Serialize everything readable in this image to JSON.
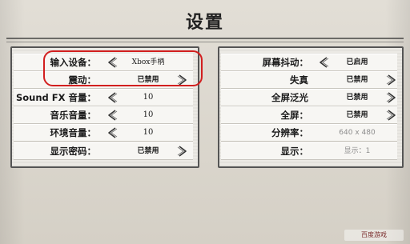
{
  "header": {
    "title": "设置"
  },
  "left_settings": [
    {
      "label": "输入设备：",
      "value": "Xbox手柄",
      "has_left_arrow": true,
      "has_right_arrow": false
    },
    {
      "label": "震动：",
      "value": "已禁用",
      "has_left_arrow": false,
      "has_right_arrow": true
    },
    {
      "label": "Sound FX 音量：",
      "value": "10",
      "has_left_arrow": true,
      "has_right_arrow": false
    },
    {
      "label": "音乐音量：",
      "value": "10",
      "has_left_arrow": true,
      "has_right_arrow": false
    },
    {
      "label": "环境音量：",
      "value": "10",
      "has_left_arrow": true,
      "has_right_arrow": false
    },
    {
      "label": "显示密码：",
      "value": "已禁用",
      "has_left_arrow": false,
      "has_right_arrow": true
    }
  ],
  "right_settings": [
    {
      "label": "屏幕抖动：",
      "value": "已启用",
      "has_left_arrow": true,
      "has_right_arrow": false,
      "disabled": false
    },
    {
      "label": "失真",
      "value": "已禁用",
      "has_left_arrow": false,
      "has_right_arrow": true,
      "disabled": false
    },
    {
      "label": "全屏泛光",
      "value": "已禁用",
      "has_left_arrow": false,
      "has_right_arrow": true,
      "disabled": false
    },
    {
      "label": "全屏：",
      "value": "已禁用",
      "has_left_arrow": false,
      "has_right_arrow": true,
      "disabled": false
    },
    {
      "label": "分辨率：",
      "value": "640 x 480",
      "has_left_arrow": false,
      "has_right_arrow": false,
      "disabled": true
    },
    {
      "label": "显示：",
      "value": "显示：1",
      "has_left_arrow": false,
      "has_right_arrow": false,
      "disabled": true
    }
  ],
  "watermark": {
    "text": "百度游戏"
  },
  "colors": {
    "highlight_ring": "#d21f1f",
    "panel_border": "#555555",
    "disabled_text": "#8c8c8c"
  },
  "icons": {
    "left_arrow": "chevron-left-icon",
    "right_arrow": "chevron-right-icon"
  }
}
